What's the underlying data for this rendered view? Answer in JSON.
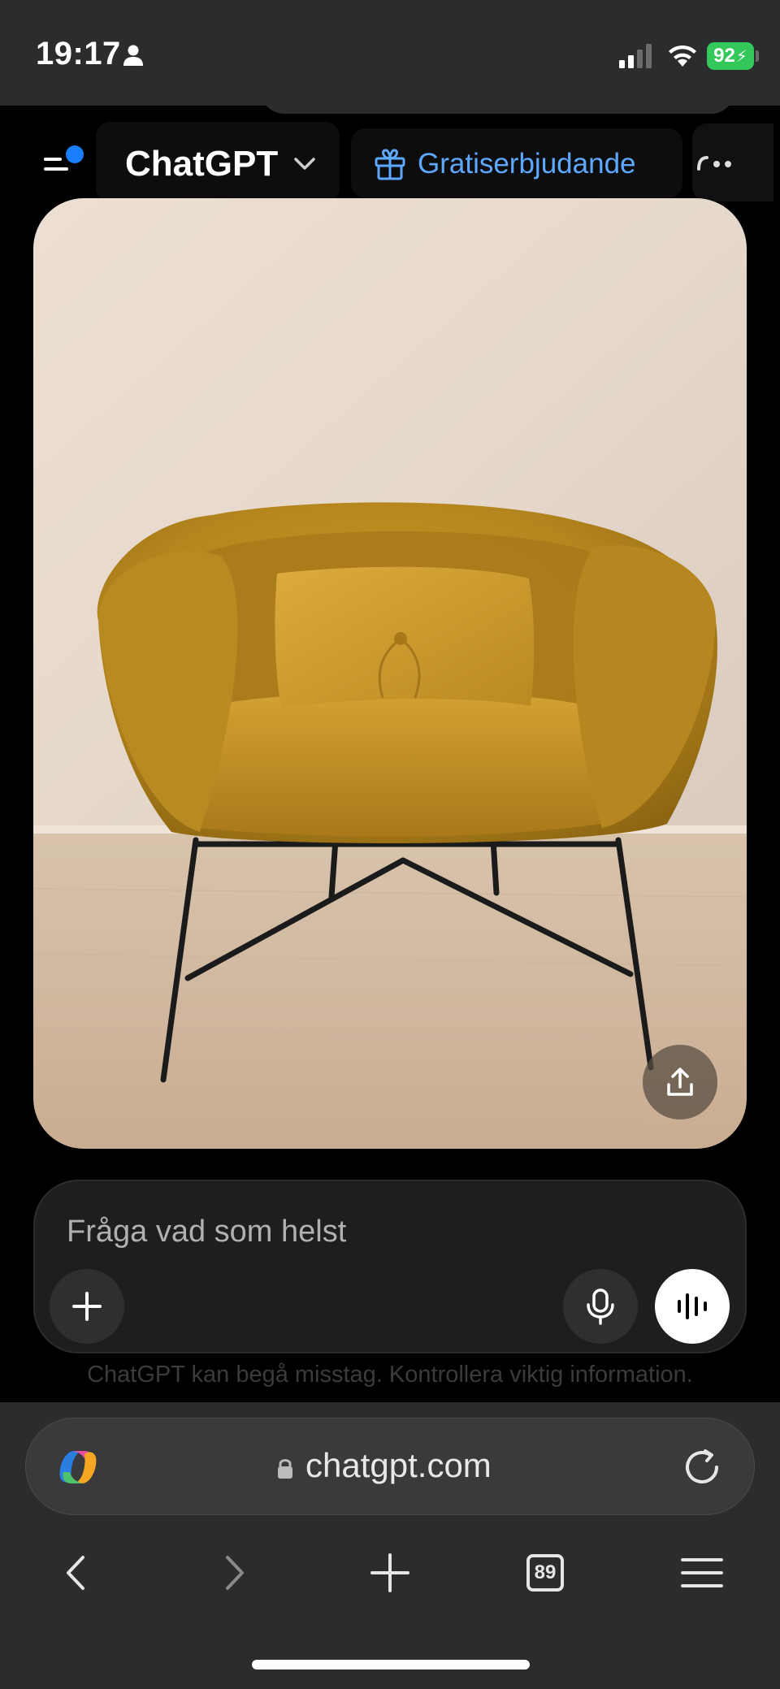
{
  "status_bar": {
    "time": "19:17",
    "battery_percent": "92",
    "icons": [
      "person-icon",
      "signal-icon",
      "wifi-icon",
      "battery-charging-icon"
    ]
  },
  "header": {
    "model_title": "ChatGPT",
    "promo_label": "Gratiserbjudande",
    "icons": [
      "sidebar-menu-icon",
      "chevron-down-icon",
      "gift-icon",
      "more-icon"
    ],
    "accent_color": "#5ea8ff",
    "notification_dot_color": "#1a7fff"
  },
  "main_image": {
    "icons": [
      "share-icon"
    ]
  },
  "composer": {
    "placeholder": "Fråga vad som helst",
    "icons": [
      "plus-icon",
      "microphone-icon",
      "voice-mode-icon"
    ]
  },
  "disclaimer": "ChatGPT kan begå misstag. Kontrollera viktig information.",
  "browser": {
    "url": "chatgpt.com",
    "tab_count": "89",
    "icons": [
      "copilot-icon",
      "lock-icon",
      "reload-icon",
      "back-icon",
      "forward-icon",
      "new-tab-icon",
      "tabs-icon",
      "menu-icon"
    ]
  }
}
